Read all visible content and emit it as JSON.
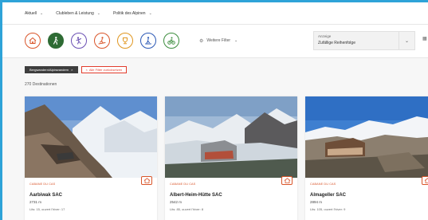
{
  "nav": {
    "items": [
      {
        "label": "Aktuell"
      },
      {
        "label": "Clubleben & Leistung"
      },
      {
        "label": "Politik des Alpinen"
      }
    ]
  },
  "filters": {
    "categories": [
      {
        "icon": "hut-icon",
        "active": false
      },
      {
        "icon": "hiker-icon",
        "active": true
      },
      {
        "icon": "climber-icon",
        "active": false
      },
      {
        "icon": "ski-tour-icon",
        "active": false
      },
      {
        "icon": "trophy-icon",
        "active": false
      },
      {
        "icon": "snowshoe-icon",
        "active": false
      },
      {
        "icon": "mountain-bike-icon",
        "active": false
      }
    ],
    "more_label": "Weitere Filter",
    "sort_label": "Anzeige",
    "sort_value": "Zufällige Reihenfolge"
  },
  "chips": {
    "active_filter": "Bergwandern/Alpinwandern",
    "reset": "Alle Filter zurücksetzen"
  },
  "results_count": "270 Destinationen",
  "cards": [
    {
      "category": "CABANE DU CAS",
      "title": "Aarbiwak SAC",
      "elevation": "2731 m",
      "beds": "Lits: 15, ouvert l'hiver: 17"
    },
    {
      "category": "CABANE DU CAS",
      "title": "Albert-Heim-Hütte SAC",
      "elevation": "2542 m",
      "beds": "Lits: 85, ouvert l'hiver: 8"
    },
    {
      "category": "CABANE DU CAS",
      "title": "Almageller SAC",
      "elevation": "2894 m",
      "beds": "Lits: 105, ouvert l'hiver: 9"
    }
  ],
  "colors": {
    "accent": "#d9552a",
    "active_category": "#2e6b34",
    "chip_dark": "#3e3e3e",
    "chip_red": "#e23c2c",
    "frame_border": "#2ea3d8"
  }
}
